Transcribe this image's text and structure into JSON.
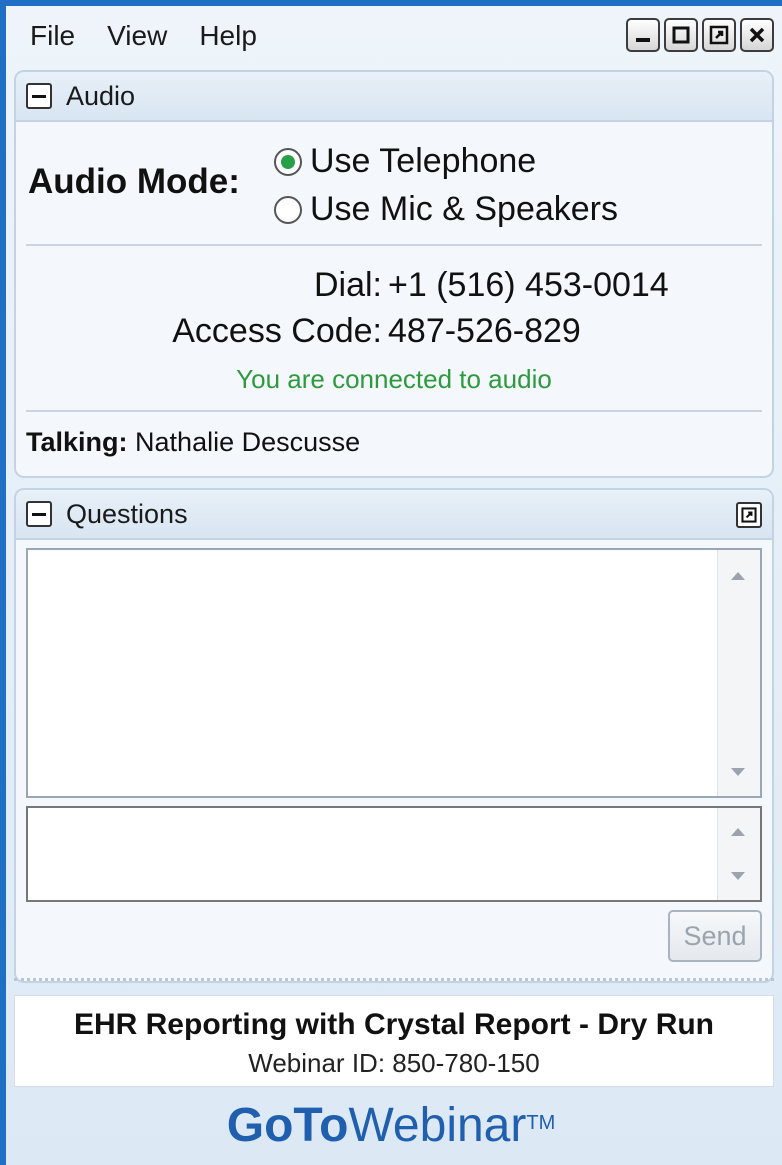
{
  "menu": {
    "file": "File",
    "view": "View",
    "help": "Help"
  },
  "audio": {
    "header": "Audio",
    "mode_label": "Audio Mode:",
    "options": [
      {
        "label": "Use Telephone",
        "selected": true
      },
      {
        "label": "Use Mic & Speakers",
        "selected": false
      }
    ],
    "dial_label": "Dial:",
    "dial_value": "+1 (516) 453-0014",
    "access_label": "Access Code:",
    "access_value": "487-526-829",
    "status": "You are connected to audio",
    "talking_label": "Talking:",
    "talking_name": "Nathalie Descusse"
  },
  "questions": {
    "header": "Questions",
    "send_label": "Send"
  },
  "webinar": {
    "title": "EHR Reporting with Crystal Report - Dry Run",
    "id_text": "Webinar ID: 850-780-150"
  },
  "brand": {
    "bold": "GoTo",
    "light": "Webinar",
    "tm": "TM"
  },
  "colors": {
    "accent": "#1f6fc4",
    "connected": "#2e9a3d",
    "radio_on": "#27a048",
    "logo": "#1f5fae"
  }
}
